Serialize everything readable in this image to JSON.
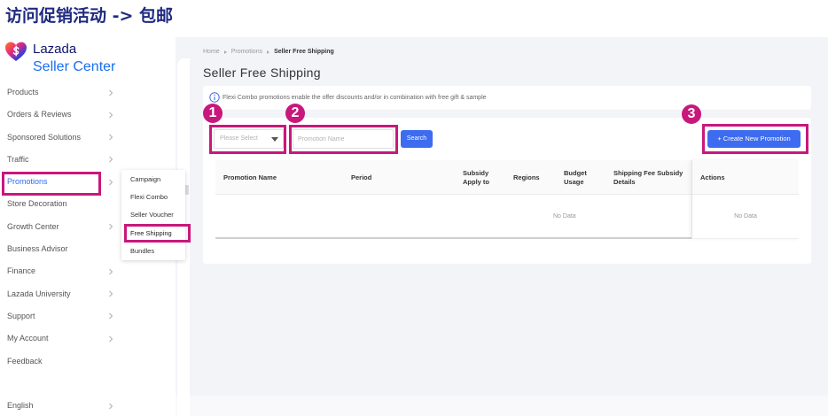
{
  "annotation": {
    "title": "访问促销活动 -> 包邮",
    "markers": [
      "1",
      "2",
      "3"
    ]
  },
  "logo": {
    "icon": "lazada-heart-logo-icon",
    "brand": "Lazada",
    "product": "Seller Center"
  },
  "sidebar": {
    "active_index": 4,
    "items": [
      {
        "label": "Products",
        "has_chevron": true
      },
      {
        "label": "Orders & Reviews",
        "has_chevron": true
      },
      {
        "label": "Sponsored Solutions",
        "has_chevron": true
      },
      {
        "label": "Traffic",
        "has_chevron": true
      },
      {
        "label": "Promotions",
        "has_chevron": true
      },
      {
        "label": "Store Decoration",
        "has_chevron": false
      },
      {
        "label": "Growth Center",
        "has_chevron": true
      },
      {
        "label": "Business Advisor",
        "has_chevron": false
      },
      {
        "label": "Finance",
        "has_chevron": true
      },
      {
        "label": "Lazada University",
        "has_chevron": true
      },
      {
        "label": "Support",
        "has_chevron": true
      },
      {
        "label": "My Account",
        "has_chevron": true
      },
      {
        "label": "Feedback",
        "has_chevron": false
      }
    ],
    "footer": {
      "label": "English",
      "icon": "chevron-right-icon"
    }
  },
  "submenu": {
    "selected_index": 3,
    "items": [
      "Campaign",
      "Flexi Combo",
      "Seller Voucher",
      "Free Shipping",
      "Bundles"
    ]
  },
  "breadcrumb": {
    "items": [
      "Home",
      "Promotions",
      "Seller Free Shipping"
    ]
  },
  "page": {
    "title": "Seller Free Shipping"
  },
  "info": {
    "icon": "info-icon",
    "text": "Flexi Combo promotions enable the offer discounts and/or in combination with free gift & sample"
  },
  "filters": {
    "select_placeholder": "Please Select",
    "name_placeholder": "Promotion Name",
    "search_label": "Search",
    "create_label": "+ Create New Promotion"
  },
  "table": {
    "columns": [
      "Promotion Name",
      "Period",
      "Subsidy Apply to",
      "Regions",
      "Budget Usage",
      "Shipping Fee Subsidy Details"
    ],
    "actions_column": "Actions",
    "empty_text": "No Data",
    "actions_empty_text": "No Data"
  },
  "colors": {
    "accent": "#3d6cf1",
    "annotation": "#c8187c",
    "caption": "#1f2a80",
    "active_nav": "#2f6bef"
  }
}
